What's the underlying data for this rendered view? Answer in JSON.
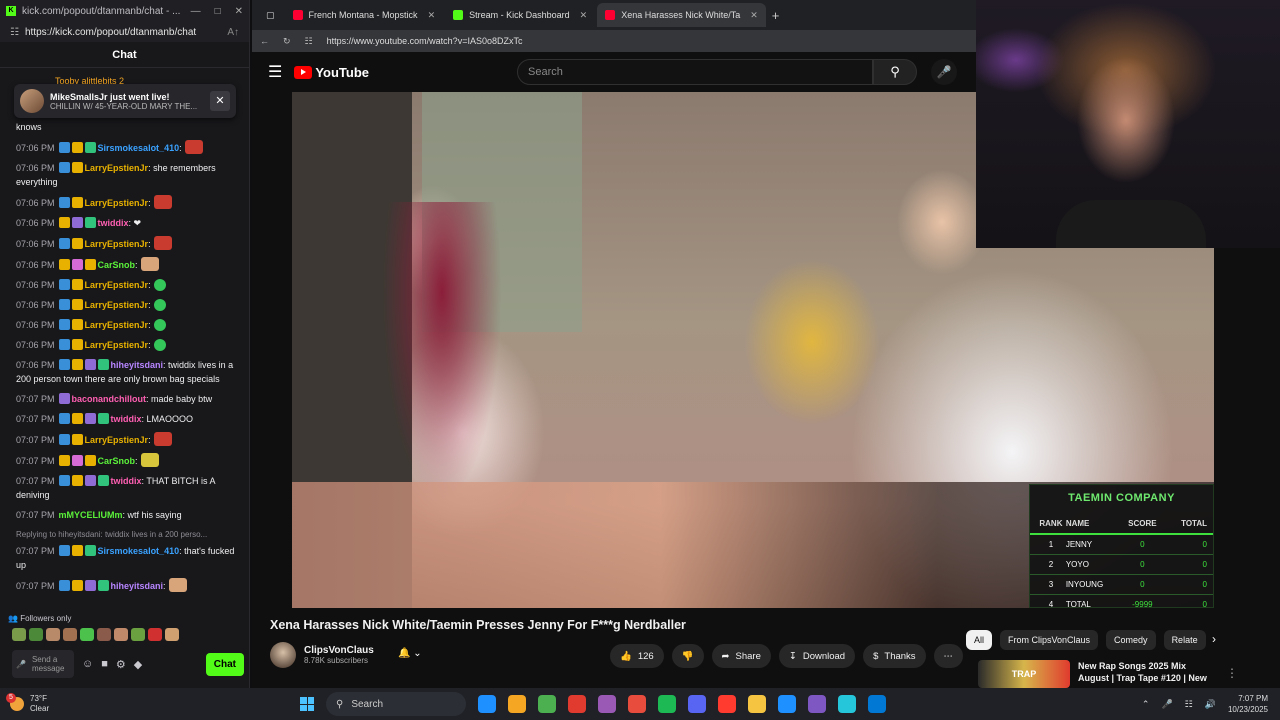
{
  "chat_window": {
    "title": "kick.com/popout/dtanmanb/chat - ...",
    "url": "https://kick.com/popout/dtanmanb/chat",
    "header": "Chat",
    "notification": {
      "name": "MikeSmallsJr just went live!",
      "sub": "CHILLIN W/ 45-YEAR-OLD MARY THE..."
    },
    "peek_line": "Tooby   alittlebits   2",
    "first_fragment": "knows",
    "messages": [
      {
        "time": "07:06 PM",
        "user": "Sirsmokesalot_410",
        "text": ":",
        "ucls": "u-blue",
        "badges": [
          "b-blue",
          "b-gold",
          "b-green"
        ],
        "emote": "e-red"
      },
      {
        "time": "07:06 PM",
        "user": "LarryEpstienJr",
        "text": ": she remembers everything",
        "ucls": "u-gold",
        "badges": [
          "b-blue",
          "b-gold"
        ],
        "emote": ""
      },
      {
        "time": "07:06 PM",
        "user": "LarryEpstienJr",
        "text": ":",
        "ucls": "u-gold",
        "badges": [
          "b-blue",
          "b-gold"
        ],
        "emote": "e-red"
      },
      {
        "time": "07:06 PM",
        "user": "twiddix",
        "text": ": ❤",
        "ucls": "u-pink",
        "badges": [
          "b-gold",
          "b-purple",
          "b-green"
        ],
        "emote": ""
      },
      {
        "time": "07:06 PM",
        "user": "LarryEpstienJr",
        "text": ":",
        "ucls": "u-gold",
        "badges": [
          "b-blue",
          "b-gold"
        ],
        "emote": "e-red"
      },
      {
        "time": "07:06 PM",
        "user": "CarSnob",
        "text": ":",
        "ucls": "u-lime",
        "badges": [
          "b-gold",
          "b-pink",
          "b-gold"
        ],
        "emote": "e-skin"
      },
      {
        "time": "07:06 PM",
        "user": "LarryEpstienJr",
        "text": ":",
        "ucls": "u-gold",
        "badges": [
          "b-blue",
          "b-gold"
        ],
        "emote": "e-green"
      },
      {
        "time": "07:06 PM",
        "user": "LarryEpstienJr",
        "text": ":",
        "ucls": "u-gold",
        "badges": [
          "b-blue",
          "b-gold"
        ],
        "emote": "e-green"
      },
      {
        "time": "07:06 PM",
        "user": "LarryEpstienJr",
        "text": ":",
        "ucls": "u-gold",
        "badges": [
          "b-blue",
          "b-gold"
        ],
        "emote": "e-green"
      },
      {
        "time": "07:06 PM",
        "user": "LarryEpstienJr",
        "text": ":",
        "ucls": "u-gold",
        "badges": [
          "b-blue",
          "b-gold"
        ],
        "emote": "e-green"
      },
      {
        "time": "07:06 PM",
        "user": "hiheyitsdani",
        "text": ": twiddix lives in a 200 person town there are only brown bag specials",
        "ucls": "u-purple",
        "badges": [
          "b-blue",
          "b-gold",
          "b-purple",
          "b-green"
        ],
        "emote": ""
      },
      {
        "time": "07:07 PM",
        "user": "baconandchillout",
        "text": ": made baby btw",
        "ucls": "u-pink",
        "badges": [
          "b-purple"
        ],
        "emote": ""
      },
      {
        "time": "07:07 PM",
        "user": "twiddix",
        "text": ": LMAOOOO",
        "ucls": "u-pink",
        "badges": [
          "b-blue",
          "b-gold",
          "b-purple",
          "b-green"
        ],
        "emote": ""
      },
      {
        "time": "07:07 PM",
        "user": "LarryEpstienJr",
        "text": ":",
        "ucls": "u-gold",
        "badges": [
          "b-blue",
          "b-gold"
        ],
        "emote": "e-red"
      },
      {
        "time": "07:07 PM",
        "user": "CarSnob",
        "text": ":",
        "ucls": "u-lime",
        "badges": [
          "b-gold",
          "b-pink",
          "b-gold"
        ],
        "emote": "e-yel"
      },
      {
        "time": "07:07 PM",
        "user": "twiddix",
        "text": ": THAT BITCH is A deniving",
        "ucls": "u-pink",
        "badges": [
          "b-blue",
          "b-gold",
          "b-purple",
          "b-green"
        ],
        "emote": ""
      },
      {
        "time": "07:07 PM",
        "user": "mMYCELIUMm",
        "text": ": wtf his saying",
        "ucls": "u-lime",
        "badges": [],
        "emote": ""
      }
    ],
    "reply_context": "Replying to hiheyitsdani: twiddix lives in a 200 perso...",
    "messages_after": [
      {
        "time": "07:07 PM",
        "user": "Sirsmokesalot_410",
        "text": ": that's fucked up",
        "ucls": "u-blue",
        "badges": [
          "b-blue",
          "b-gold",
          "b-green"
        ],
        "emote": ""
      },
      {
        "time": "07:07 PM",
        "user": "hiheyitsdani",
        "text": ":",
        "ucls": "u-purple",
        "badges": [
          "b-blue",
          "b-gold",
          "b-purple",
          "b-green"
        ],
        "emote": "e-skin"
      }
    ],
    "followers_only": "Followers only",
    "input_placeholder": "Send a message",
    "chat_button": "Chat"
  },
  "browser": {
    "tabs": [
      {
        "label": "French Montana - Mopstick",
        "icon_color": "#ff0033",
        "active": false
      },
      {
        "label": "Stream - Kick Dashboard",
        "icon_color": "#53fc18",
        "active": false
      },
      {
        "label": "Xena Harasses Nick White/Ta",
        "icon_color": "#ff0033",
        "active": true
      }
    ],
    "new_tab": "+",
    "url": "https://www.youtube.com/watch?v=IAS0o8DZxTc"
  },
  "youtube": {
    "logo": "YouTube",
    "search_placeholder": "Search",
    "scoreboard": {
      "title": "TAEMIN COMPANY",
      "headers": [
        "RANK",
        "NAME",
        "SCORE",
        "TOTAL"
      ],
      "rows": [
        [
          "1",
          "JENNY",
          "0",
          "0"
        ],
        [
          "2",
          "YOYO",
          "0",
          "0"
        ],
        [
          "3",
          "INYOUNG",
          "0",
          "0"
        ],
        [
          "4",
          "TOTAL",
          "-9999",
          "0"
        ]
      ]
    },
    "video_title": "Xena Harasses Nick White/Taemin Presses Jenny For F***g Nerdballer",
    "channel_name": "ClipsVonClaus",
    "subscribers": "8.78K subscribers",
    "like_count": "126",
    "share": "Share",
    "download": "Download",
    "thanks": "Thanks",
    "chips": [
      "All",
      "From ClipsVonClaus",
      "Comedy",
      "Relate"
    ],
    "related_title": "New Rap Songs 2025 Mix August | Trap Tape #120 | New",
    "related_thumb": "TRAP"
  },
  "taskbar": {
    "temp": "73°F",
    "condition": "Clear",
    "notif_count": "5",
    "search": "Search",
    "app_colors": [
      "#1e90ff",
      "#f5a623",
      "#4caf50",
      "#e03b2e",
      "#9b59b6",
      "#e74c3c",
      "#1db954",
      "#5865f2",
      "#ff3b30",
      "#f5c542",
      "#1e90ff",
      "#7e57c2",
      "#26c6da",
      "#0078d4"
    ],
    "time": "7:07 PM",
    "date": "10/23/2025"
  }
}
